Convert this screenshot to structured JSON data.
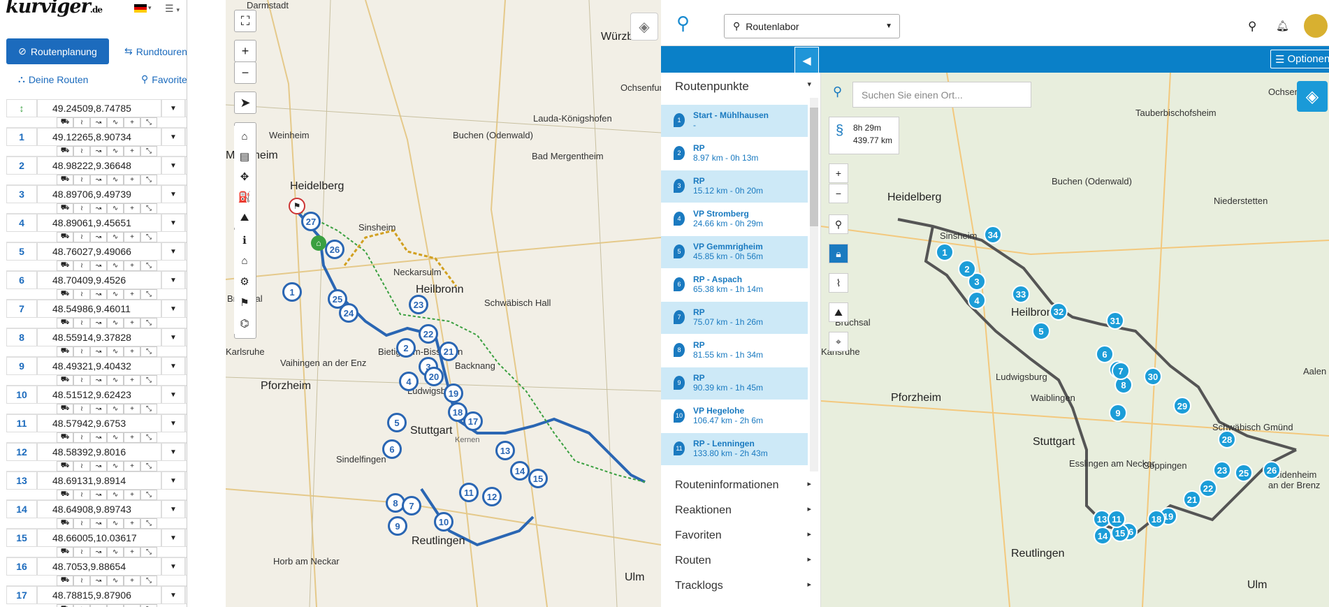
{
  "left": {
    "logo": "kurviger",
    "logo_tld": ".de",
    "tabs": {
      "primary": "Routenplanung",
      "secondary": "Rundtouren",
      "routes": "Deine Routen",
      "favorites": "Favoriten"
    },
    "waypoints": [
      {
        "num": "",
        "coord": "49.24509,8.74785"
      },
      {
        "num": "1",
        "coord": "49.12265,8.90734"
      },
      {
        "num": "2",
        "coord": "48.98222,9.36648"
      },
      {
        "num": "3",
        "coord": "48.89706,9.49739"
      },
      {
        "num": "4",
        "coord": "48.89061,9.45651"
      },
      {
        "num": "5",
        "coord": "48.76027,9.49066"
      },
      {
        "num": "6",
        "coord": "48.70409,9.4526"
      },
      {
        "num": "7",
        "coord": "48.54986,9.46011"
      },
      {
        "num": "8",
        "coord": "48.55914,9.37828"
      },
      {
        "num": "9",
        "coord": "48.49321,9.40432"
      },
      {
        "num": "10",
        "coord": "48.51512,9.62423"
      },
      {
        "num": "11",
        "coord": "48.57942,9.6753"
      },
      {
        "num": "12",
        "coord": "48.58392,9.8016"
      },
      {
        "num": "13",
        "coord": "48.69131,9.8914"
      },
      {
        "num": "14",
        "coord": "48.64908,9.89743"
      },
      {
        "num": "15",
        "coord": "48.66005,10.03617"
      },
      {
        "num": "16",
        "coord": "48.7053,9.88654"
      },
      {
        "num": "17",
        "coord": "48.78815,9.87906"
      }
    ]
  },
  "map1": {
    "cities": [
      "Darmstadt",
      "Würzb",
      "Heidelberg",
      "Heilbronn",
      "Sinsheim",
      "Neckarsulm",
      "Schwäbisch Hall",
      "Buchen (Odenwald)",
      "Bad Mergentheim",
      "Bruchsal",
      "Pforzheim",
      "Ludwigsburg",
      "Stuttgart",
      "Sindelfingen",
      "Reutlingen",
      "Horb am Neckar",
      "Ulm",
      "Bietigheim-Bissingen",
      "Vaihingen an der Enz",
      "Lauda-Königshofen",
      "Weinheim",
      "Mannheim",
      "Karlsruhe",
      "Backnang",
      "Kernen",
      "Ochsenfurt",
      "Ochsenfurt"
    ],
    "markers": [
      "27",
      "26",
      "1",
      "25",
      "24",
      "23",
      "22",
      "2",
      "21",
      "3",
      "4",
      "20",
      "19",
      "18",
      "17",
      "5",
      "6",
      "13",
      "14",
      "15",
      "8",
      "7",
      "11",
      "12",
      "9",
      "10"
    ]
  },
  "app": {
    "location_select": "Routenlabor",
    "options_label": "Optionen",
    "section_routepoints": "Routenpunkte",
    "routepoints": [
      {
        "n": "1",
        "title": "Start - Mühlhausen",
        "sub": "-"
      },
      {
        "n": "2",
        "title": "RP",
        "sub": "8.97 km -     0h 13m"
      },
      {
        "n": "3",
        "title": "RP",
        "sub": "15.12 km -     0h 20m"
      },
      {
        "n": "4",
        "title": "VP Stromberg",
        "sub": "24.66 km -     0h 29m"
      },
      {
        "n": "5",
        "title": "VP Gemmrigheim",
        "sub": "45.85 km -     0h 56m"
      },
      {
        "n": "6",
        "title": "RP - Aspach",
        "sub": "65.38 km -     1h 14m"
      },
      {
        "n": "7",
        "title": "RP",
        "sub": "75.07 km -     1h 26m"
      },
      {
        "n": "8",
        "title": "RP",
        "sub": "81.55 km -     1h 34m"
      },
      {
        "n": "9",
        "title": "RP",
        "sub": "90.39 km -     1h 45m"
      },
      {
        "n": "10",
        "title": "VP Hegelohe",
        "sub": "106.47 km -    2h 6m"
      },
      {
        "n": "11",
        "title": "RP - Lenningen",
        "sub": "133.80 km -    2h 43m"
      }
    ],
    "sections": [
      "Routeninformationen",
      "Reaktionen",
      "Favoriten",
      "Routen",
      "Tracklogs"
    ],
    "search_placeholder": "Suchen Sie einen Ort...",
    "summary_time": "8h 29m",
    "summary_dist": "439.77 km"
  },
  "map2": {
    "cities": [
      "Heidelberg",
      "Stuttgart",
      "Heilbronn",
      "Pforzheim",
      "Reutlingen",
      "Esslingen am Neckar",
      "Göppingen",
      "Waiblingen",
      "Ludwigsburg",
      "Schwäbisch Gmünd",
      "Sinsheim",
      "Bruchsal",
      "Karlsruhe",
      "Buchen (Odenwald)",
      "Niederstetten",
      "Ochsenfurt",
      "Tauberbischofsheim",
      "Aalen",
      "Heidenheim an der Brenz",
      "Ulm"
    ],
    "markers": [
      "34",
      "33",
      "32",
      "31",
      "30",
      "29",
      "28",
      "26",
      "25",
      "23",
      "22",
      "21",
      "19",
      "18",
      "16",
      "15",
      "14",
      "13",
      "11",
      "10",
      "9",
      "8",
      "7",
      "6",
      "5",
      "4",
      "3",
      "2",
      "1"
    ]
  }
}
